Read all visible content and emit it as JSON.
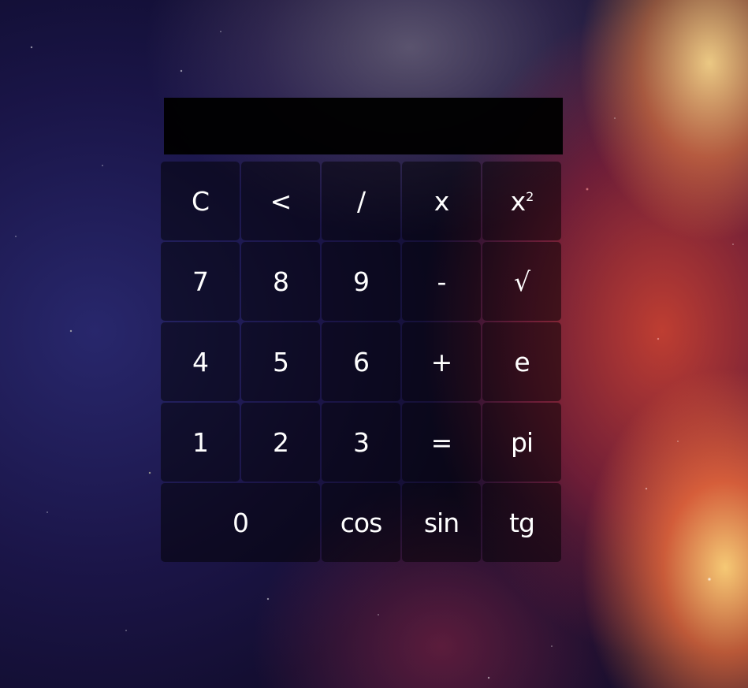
{
  "display": {
    "value": ""
  },
  "keys": {
    "clear": "C",
    "backspace": "<",
    "divide": "/",
    "multiply": "x",
    "square_base": "x",
    "square_exp": "2",
    "seven": "7",
    "eight": "8",
    "nine": "9",
    "minus": "-",
    "sqrt": "√",
    "four": "4",
    "five": "5",
    "six": "6",
    "plus": "+",
    "e": "e",
    "one": "1",
    "two": "2",
    "three": "3",
    "equals": "=",
    "pi": "pi",
    "zero": "0",
    "cos": "cos",
    "sin": "sin",
    "tg": "tg"
  }
}
